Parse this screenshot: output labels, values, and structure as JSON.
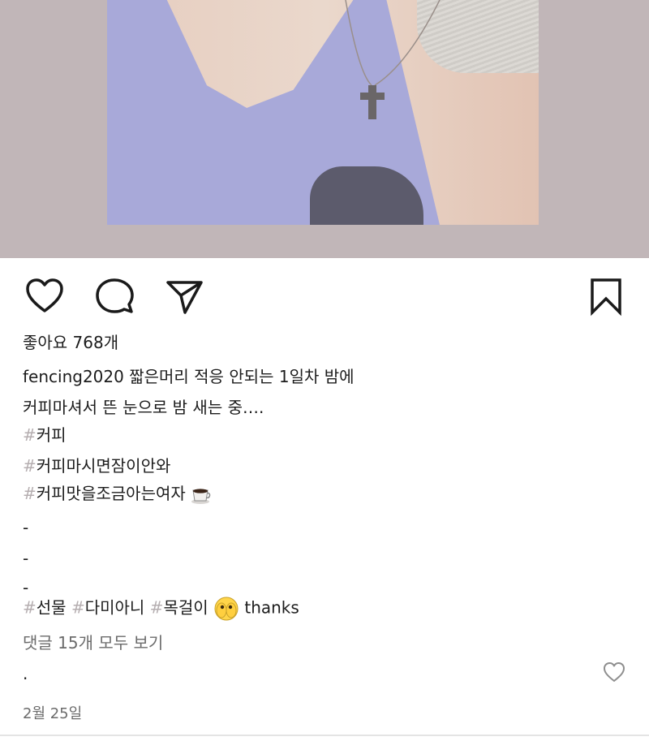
{
  "post": {
    "likes_text": "좋아요 768개",
    "caption": {
      "username": "fencing2020",
      "line1_text": "짧은머리 적응 안되는 1일차 밤에",
      "line2_text": "커피마셔서 뜬 눈으로 밤 새는 중…."
    },
    "hashtags_block1": [
      {
        "hash": "#",
        "text": "커피"
      },
      {
        "hash": "#",
        "text": "커피마시면잠이안와"
      },
      {
        "hash": "#",
        "text": "커피맛을조금아는여자"
      }
    ],
    "dashes": [
      "-",
      "-",
      "-"
    ],
    "hashtags_block2": [
      {
        "hash": "#",
        "text": "선물"
      },
      {
        "hash": "#",
        "text": "다미아니"
      },
      {
        "hash": "#",
        "text": "목걸이"
      }
    ],
    "thanks_text": "thanks",
    "view_comments_text": "댓글 15개 모두 보기",
    "comment_preview": ".",
    "date_text": "2월 25일"
  },
  "icons": {
    "like": "heart-outline-icon",
    "comment": "speech-bubble-icon",
    "share": "paper-plane-icon",
    "save": "bookmark-icon",
    "coffee_emoji": "coffee-cup-emoji",
    "flushed_emoji": "peeking-face-emoji",
    "comment_like": "small-heart-icon"
  },
  "colors": {
    "hashtag_symbol": "#b5aeb0",
    "photo_background": "#c1b6b8",
    "text": "#1c1c1c"
  }
}
